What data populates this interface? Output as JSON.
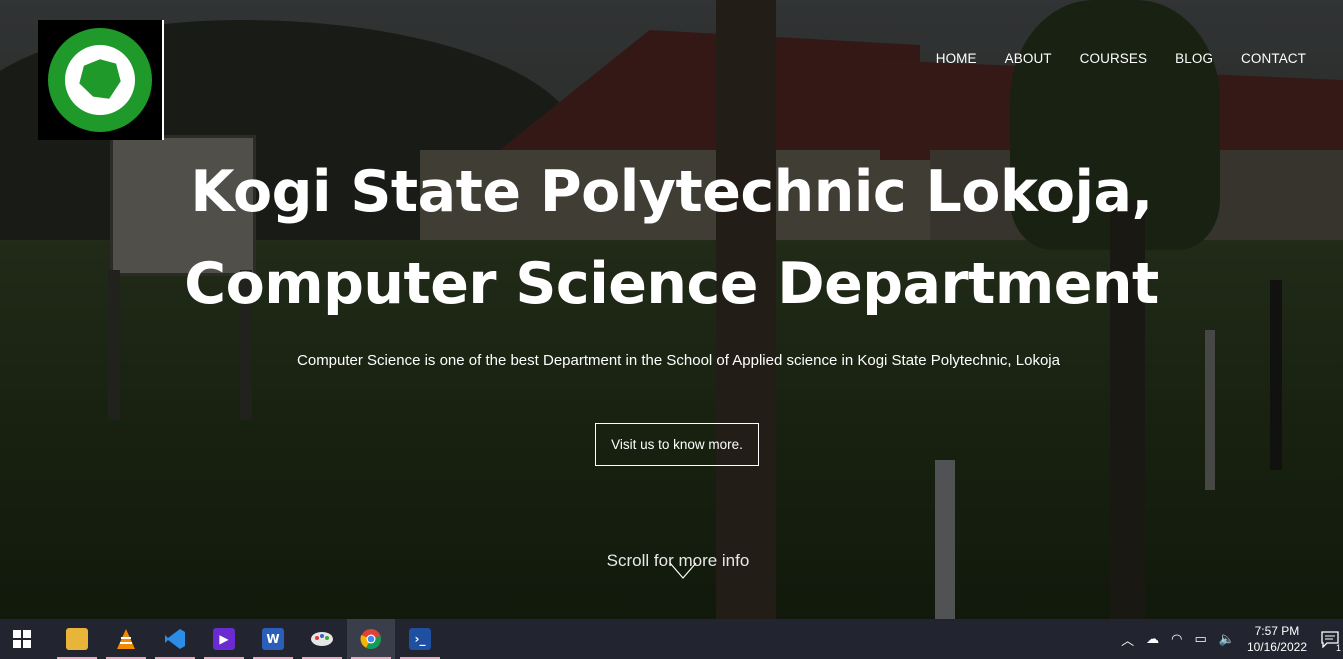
{
  "header": {
    "logo_alt": "NIGERIA ASSOCIATION OF COMPUTING STUDENTS NACOS",
    "nav": [
      {
        "label": "HOME"
      },
      {
        "label": "ABOUT"
      },
      {
        "label": "COURSES"
      },
      {
        "label": "BLOG"
      },
      {
        "label": "CONTACT"
      }
    ]
  },
  "hero": {
    "title_line1": "Kogi State Polytechnic Lokoja,",
    "title_line2": "Computer Science Department",
    "subtitle": "Computer Science is one of the best Department in the School of Applied science in Kogi State Polytechnic, Lokoja",
    "cta_label": "Visit us to know more.",
    "scroll_label": "Scroll for more info"
  },
  "taskbar": {
    "apps": [
      {
        "name": "file-explorer-icon"
      },
      {
        "name": "vlc-icon"
      },
      {
        "name": "vscode-icon"
      },
      {
        "name": "video-player-icon"
      },
      {
        "name": "word-icon"
      },
      {
        "name": "paint-icon"
      },
      {
        "name": "chrome-icon",
        "active": true
      },
      {
        "name": "powershell-icon"
      }
    ],
    "clock_time": "7:57 PM",
    "clock_date": "10/16/2022",
    "notification_count": "1"
  }
}
